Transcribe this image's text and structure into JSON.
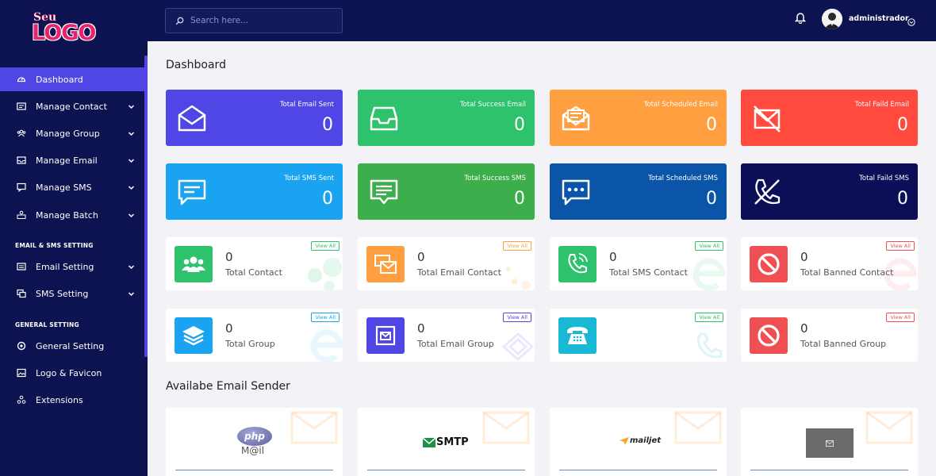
{
  "logo": {
    "top": "Seu",
    "main": "LOGO"
  },
  "sidebar": {
    "items": [
      {
        "label": "Dashboard",
        "icon": "gauge-icon",
        "active": true
      },
      {
        "label": "Manage Contact",
        "icon": "contact-card-icon",
        "has_submenu": true
      },
      {
        "label": "Manage Group",
        "icon": "group-icon",
        "has_submenu": true
      },
      {
        "label": "Manage Email",
        "icon": "inbox-icon",
        "has_submenu": true
      },
      {
        "label": "Manage SMS",
        "icon": "chat-icon",
        "has_submenu": true
      },
      {
        "label": "Manage Batch",
        "icon": "batch-icon",
        "has_submenu": true
      }
    ],
    "section_email_sms": "EMAIL & SMS SETTING",
    "setting_items": [
      {
        "label": "Email Setting",
        "icon": "email-setting-icon",
        "has_submenu": true
      },
      {
        "label": "SMS Setting",
        "icon": "sms-setting-icon",
        "has_submenu": true
      }
    ],
    "section_general": "GENERAL SETTING",
    "general_items": [
      {
        "label": "General Setting",
        "icon": "settings-icon"
      },
      {
        "label": "Logo & Favicon",
        "icon": "image-icon"
      },
      {
        "label": "Extensions",
        "icon": "extensions-icon"
      }
    ]
  },
  "topbar": {
    "search_placeholder": "Search here...",
    "username": "administrador"
  },
  "page_title": "Dashboard",
  "stats": [
    {
      "label": "Total Email Sent",
      "value": "0",
      "color": "#4f46e5",
      "icon": "envelope-icon"
    },
    {
      "label": "Total Success Email",
      "value": "0",
      "color": "#2dc26b",
      "icon": "tray-icon"
    },
    {
      "label": "Total Scheduled Email",
      "value": "0",
      "color": "#ff9f40",
      "icon": "envelope-open-icon"
    },
    {
      "label": "Total Faild Email",
      "value": "0",
      "color": "#ff4a3d",
      "icon": "envelope-slash-icon"
    },
    {
      "label": "Total SMS Sent",
      "value": "0",
      "color": "#1aa3f0",
      "icon": "message-icon"
    },
    {
      "label": "Total Success SMS",
      "value": "0",
      "color": "#3dae4c",
      "icon": "message-lines-icon"
    },
    {
      "label": "Total Scheduled SMS",
      "value": "0",
      "color": "#0b55a8",
      "icon": "message-dots-icon"
    },
    {
      "label": "Total Faild SMS",
      "value": "0",
      "color": "#0c0f57",
      "icon": "phone-slash-icon"
    }
  ],
  "contact_cards": [
    {
      "value": "0",
      "label": "Total Contact",
      "view_all": "View All",
      "icon_color": "#2dc26b",
      "badge_color": "#2dc26b",
      "icon": "users-icon"
    },
    {
      "value": "0",
      "label": "Total Email Contact",
      "view_all": "View All",
      "icon_color": "#ff9f40",
      "badge_color": "#ff9f40",
      "icon": "email-contact-icon"
    },
    {
      "value": "0",
      "label": "Total SMS Contact",
      "view_all": "View All",
      "icon_color": "#2dc26b",
      "badge_color": "#2dc26b",
      "icon": "phone-volume-icon"
    },
    {
      "value": "0",
      "label": "Total Banned Contact",
      "view_all": "View All",
      "icon_color": "#f05054",
      "badge_color": "#f05054",
      "icon": "ban-icon"
    }
  ],
  "group_cards": [
    {
      "value": "0",
      "label": "Total Group",
      "view_all": "View All",
      "icon_color": "#1aa3f0",
      "badge_color": "#1aa3f0",
      "icon": "layers-icon"
    },
    {
      "value": "0",
      "label": "Total Email Group",
      "view_all": "View All",
      "icon_color": "#4f46e5",
      "badge_color": "#4f46e5",
      "icon": "email-group-icon"
    },
    {
      "value": "",
      "label": "",
      "view_all": "View All",
      "icon_color": "#19b8d4",
      "badge_color": "#2dc26b",
      "icon": "telephone-icon"
    },
    {
      "value": "0",
      "label": "Total Banned Group",
      "view_all": "View All",
      "icon_color": "#f05054",
      "badge_color": "#f05054",
      "icon": "ban-icon"
    }
  ],
  "sender_section_title": "Availabe Email Sender",
  "senders": [
    {
      "name": "php",
      "sub": "M@il",
      "icon": "php-mail-logo"
    },
    {
      "name": "SMTP",
      "icon": "smtp-logo"
    },
    {
      "name": "mailjet",
      "icon": "mailjet-logo"
    },
    {
      "name": "",
      "icon": "placeholder-image-icon"
    }
  ]
}
